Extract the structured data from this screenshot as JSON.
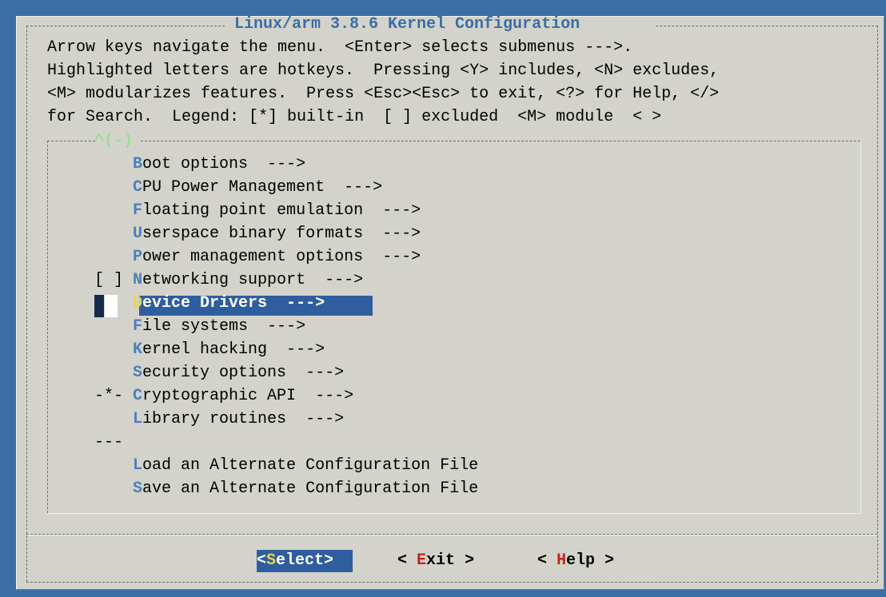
{
  "window": {
    "title": " Linux/arm 3.8.6 Kernel Configuration "
  },
  "help_lines": [
    "Arrow keys navigate the menu.  <Enter> selects submenus --->.",
    "Highlighted letters are hotkeys.  Pressing <Y> includes, <N> excludes,",
    "<M> modularizes features.  Press <Esc><Esc> to exit, <?> for Help, </>",
    "for Search.  Legend: [*] built-in  [ ] excluded  <M> module  < >"
  ],
  "scroll_indicator": "^(-)",
  "menu": {
    "items": [
      {
        "prefix": "    ",
        "hotkey": "B",
        "rest": "oot options  --->"
      },
      {
        "prefix": "    ",
        "hotkey": "C",
        "rest": "PU Power Management  --->"
      },
      {
        "prefix": "    ",
        "hotkey": "F",
        "rest": "loating point emulation  --->"
      },
      {
        "prefix": "    ",
        "hotkey": "U",
        "rest": "serspace binary formats  --->"
      },
      {
        "prefix": "    ",
        "hotkey": "P",
        "rest": "ower management options  --->"
      },
      {
        "prefix": "[ ] ",
        "hotkey": "N",
        "rest": "etworking support  --->"
      },
      {
        "prefix": "    ",
        "hotkey": "D",
        "rest": "evice Drivers  --->",
        "selected": true
      },
      {
        "prefix": "    ",
        "hotkey": "F",
        "rest": "ile systems  --->"
      },
      {
        "prefix": "    ",
        "hotkey": "K",
        "rest": "ernel hacking  --->"
      },
      {
        "prefix": "    ",
        "hotkey": "S",
        "rest": "ecurity options  --->"
      },
      {
        "prefix": "-*- ",
        "hotkey": "C",
        "rest": "ryptographic API  --->"
      },
      {
        "prefix": "    ",
        "hotkey": "L",
        "rest": "ibrary routines  --->"
      },
      {
        "prefix": "---",
        "hotkey": "",
        "rest": ""
      },
      {
        "prefix": "    ",
        "hotkey": "L",
        "rest": "oad an Alternate Configuration File"
      },
      {
        "prefix": "    ",
        "hotkey": "S",
        "rest": "ave an Alternate Configuration File"
      }
    ]
  },
  "buttons": {
    "select": {
      "open": "<",
      "hotkey": "S",
      "rest": "elect",
      "close": ">"
    },
    "exit": {
      "open": "< ",
      "hotkey": "E",
      "rest": "xit",
      "close": " >"
    },
    "help": {
      "open": "< ",
      "hotkey": "H",
      "rest": "elp",
      "close": " >"
    }
  },
  "colors": {
    "background": "#3a6ea5",
    "dialog": "#d3d3cb",
    "hotkey": "#4a7fbf",
    "selection": "#2f5e9e",
    "button_hotkey": "#c8221a"
  }
}
